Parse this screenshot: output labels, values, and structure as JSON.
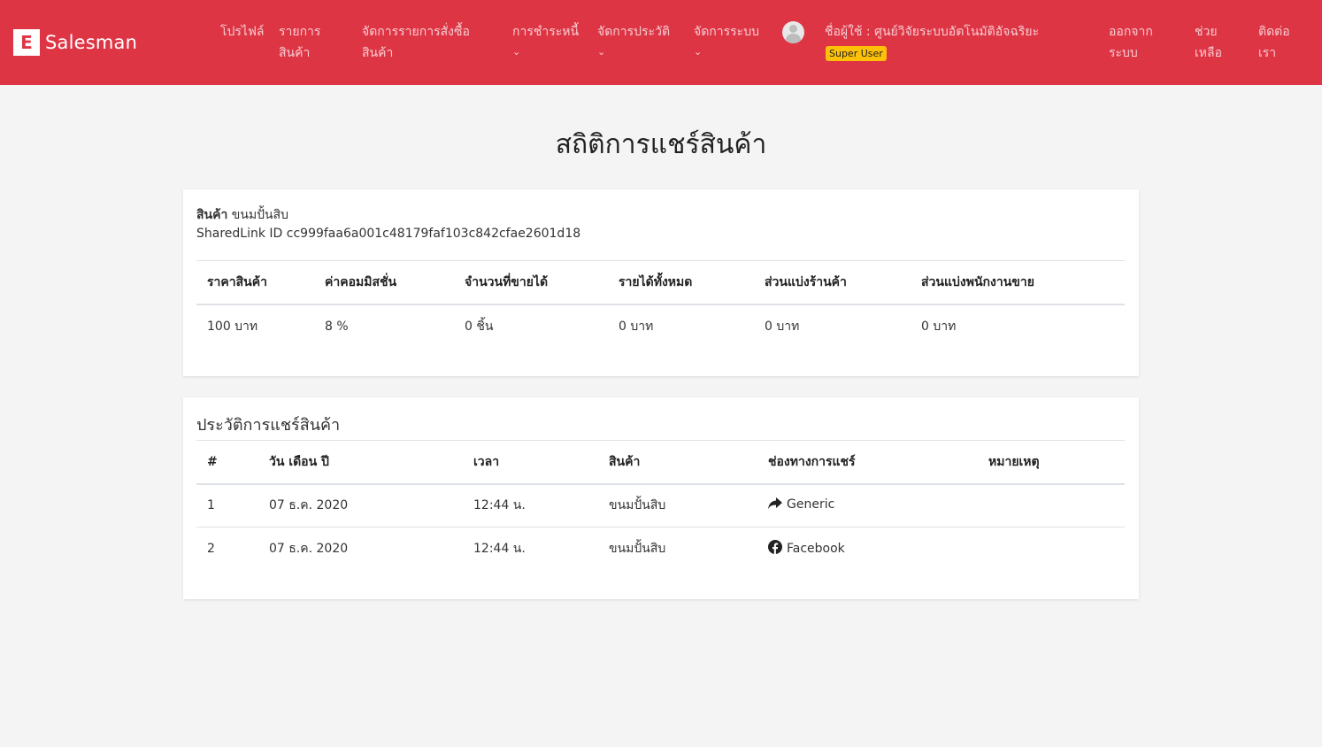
{
  "brand": {
    "logo_letter": "E",
    "name": "Salesman"
  },
  "nav": {
    "profile": "โปรไฟล์",
    "products": [
      "รายการ",
      "สินค้า"
    ],
    "orders": [
      "จัดการรายการสั่งซื้อ",
      "สินค้า"
    ],
    "debt": "การชำระหนี้",
    "history": "จัดการประวัติ",
    "system": "จัดการระบบ",
    "user_label": "ชื่อผู้ใช้ : ศูนย์วิจัยระบบอัตโนมัติอัจฉริยะ",
    "user_badge": "Super User",
    "logout": [
      "ออกจาก",
      "ระบบ"
    ],
    "help": [
      "ช่วย",
      "เหลือ"
    ],
    "contact": [
      "ติดต่อ",
      "เรา"
    ]
  },
  "page_title": "สถิติการแชร์สินค้า",
  "product_info": {
    "product_label": "สินค้า",
    "product_name": "ขนมปั้นสิบ",
    "shared_link": "SharedLink ID cc999faa6a001c48179faf103c842cfae2601d18"
  },
  "stats": {
    "headers": [
      "ราคาสินค้า",
      "ค่าคอมมิสชั่น",
      "จำนวนที่ขายได้",
      "รายได้ทั้งหมด",
      "ส่วนแบ่งร้านค้า",
      "ส่วนแบ่งพนักงานขาย"
    ],
    "values": [
      "100 บาท",
      "8 %",
      "0 ชิ้น",
      "0 บาท",
      "0 บาท",
      "0 บาท"
    ]
  },
  "history": {
    "title": "ประวัติการแชร์สินค้า",
    "headers": [
      "#",
      "วัน เดือน ปี",
      "เวลา",
      "สินค้า",
      "ช่องทางการแชร์",
      "หมายเหตุ"
    ],
    "rows": [
      {
        "no": "1",
        "date": "07 ธ.ค. 2020",
        "time": "12:44 น.",
        "product": "ขนมปั้นสิบ",
        "channel": "Generic",
        "channel_icon": "share-icon",
        "note": ""
      },
      {
        "no": "2",
        "date": "07 ธ.ค. 2020",
        "time": "12:44 น.",
        "product": "ขนมปั้นสิบ",
        "channel": "Facebook",
        "channel_icon": "facebook-icon",
        "note": ""
      }
    ]
  },
  "colors": {
    "navbar": "#de3545",
    "badge": "#ffc107",
    "background": "#f4f4f4"
  }
}
